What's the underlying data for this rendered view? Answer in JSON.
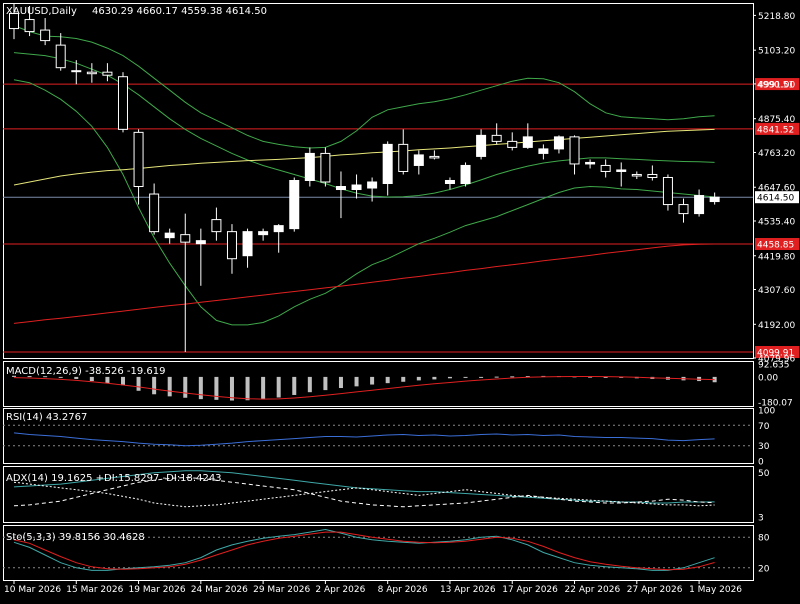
{
  "header": {
    "symbol": "XAUUSD,Daily",
    "ohlc": "4630.29 4660.17 4559.38 4614.50"
  },
  "colors": {
    "background": "#000000",
    "border": "#ffffff",
    "bull_body": "#ffffff",
    "bear_body": "#000000",
    "bollinger": "#3fa84a",
    "ma_yellow": "#e6e67a",
    "ma_red": "#e02020",
    "hline_red": "#e02020",
    "price_line": "#7b8aa8",
    "macd_hist": "#c0c0c0",
    "macd_signal": "#e02020",
    "rsi": "#3b6fd8",
    "adx_main": "#3fa8a8",
    "adx_dash": "#ffffff",
    "stoch_main": "#3fa8a8",
    "stoch_signal": "#e02020"
  },
  "chart_data": [
    {
      "type": "candlestick",
      "ylim": [
        4079.96,
        5260
      ],
      "yticks": [
        "5218.80",
        "5103.20",
        "4991.00",
        "4875.40",
        "4763.20",
        "4647.60",
        "4535.40",
        "4419.80",
        "4307.60",
        "4192.00",
        "4079.96"
      ],
      "price_tags": [
        {
          "label": "4990.51",
          "value": 4990.51
        },
        {
          "label": "4841.52",
          "value": 4841.52
        },
        {
          "label": "4614.50",
          "value": 4614.5
        },
        {
          "label": "4458.85",
          "value": 4458.85
        },
        {
          "label": "4099.91",
          "value": 4099.91
        }
      ],
      "xlabels": [
        {
          "label": "10 Mar 2026",
          "index": 0
        },
        {
          "label": "15 Mar 2026",
          "index": 4
        },
        {
          "label": "19 Mar 2026",
          "index": 8
        },
        {
          "label": "24 Mar 2026",
          "index": 12
        },
        {
          "label": "29 Mar 2026",
          "index": 16
        },
        {
          "label": "2 Apr 2026",
          "index": 20
        },
        {
          "label": "8 Apr 2026",
          "index": 24
        },
        {
          "label": "13 Apr 2026",
          "index": 28
        },
        {
          "label": "17 Apr 2026",
          "index": 32
        },
        {
          "label": "22 Apr 2026",
          "index": 36
        },
        {
          "label": "27 Apr 2026",
          "index": 40
        },
        {
          "label": "1 May 2026",
          "index": 44
        }
      ],
      "candles": [
        {
          "o": 5225,
          "h": 5260,
          "l": 5140,
          "c": 5175
        },
        {
          "o": 5205,
          "h": 5250,
          "l": 5150,
          "c": 5165
        },
        {
          "o": 5170,
          "h": 5210,
          "l": 5120,
          "c": 5135
        },
        {
          "o": 5120,
          "h": 5160,
          "l": 5035,
          "c": 5045
        },
        {
          "o": 5035,
          "h": 5070,
          "l": 4990,
          "c": 5035
        },
        {
          "o": 5030,
          "h": 5060,
          "l": 4995,
          "c": 5025
        },
        {
          "o": 5030,
          "h": 5060,
          "l": 5000,
          "c": 5020
        },
        {
          "o": 5015,
          "h": 5030,
          "l": 4830,
          "c": 4840
        },
        {
          "o": 4830,
          "h": 4840,
          "l": 4590,
          "c": 4650
        },
        {
          "o": 4625,
          "h": 4660,
          "l": 4490,
          "c": 4500
        },
        {
          "o": 4480,
          "h": 4510,
          "l": 4460,
          "c": 4495
        },
        {
          "o": 4490,
          "h": 4560,
          "l": 4100,
          "c": 4465
        },
        {
          "o": 4460,
          "h": 4510,
          "l": 4320,
          "c": 4470
        },
        {
          "o": 4540,
          "h": 4580,
          "l": 4470,
          "c": 4500
        },
        {
          "o": 4500,
          "h": 4525,
          "l": 4360,
          "c": 4410
        },
        {
          "o": 4420,
          "h": 4510,
          "l": 4380,
          "c": 4500
        },
        {
          "o": 4490,
          "h": 4510,
          "l": 4470,
          "c": 4500
        },
        {
          "o": 4500,
          "h": 4525,
          "l": 4430,
          "c": 4520
        },
        {
          "o": 4510,
          "h": 4680,
          "l": 4500,
          "c": 4670
        },
        {
          "o": 4670,
          "h": 4780,
          "l": 4650,
          "c": 4760
        },
        {
          "o": 4760,
          "h": 4780,
          "l": 4650,
          "c": 4665
        },
        {
          "o": 4640,
          "h": 4700,
          "l": 4545,
          "c": 4650
        },
        {
          "o": 4640,
          "h": 4690,
          "l": 4610,
          "c": 4655
        },
        {
          "o": 4645,
          "h": 4680,
          "l": 4600,
          "c": 4665
        },
        {
          "o": 4660,
          "h": 4800,
          "l": 4620,
          "c": 4790
        },
        {
          "o": 4790,
          "h": 4840,
          "l": 4690,
          "c": 4700
        },
        {
          "o": 4720,
          "h": 4770,
          "l": 4690,
          "c": 4755
        },
        {
          "o": 4750,
          "h": 4770,
          "l": 4740,
          "c": 4745
        },
        {
          "o": 4660,
          "h": 4680,
          "l": 4640,
          "c": 4670
        },
        {
          "o": 4660,
          "h": 4730,
          "l": 4650,
          "c": 4720
        },
        {
          "o": 4750,
          "h": 4840,
          "l": 4740,
          "c": 4820
        },
        {
          "o": 4820,
          "h": 4860,
          "l": 4790,
          "c": 4800
        },
        {
          "o": 4800,
          "h": 4830,
          "l": 4770,
          "c": 4780
        },
        {
          "o": 4780,
          "h": 4860,
          "l": 4775,
          "c": 4815
        },
        {
          "o": 4760,
          "h": 4790,
          "l": 4740,
          "c": 4775
        },
        {
          "o": 4775,
          "h": 4820,
          "l": 4760,
          "c": 4815
        },
        {
          "o": 4815,
          "h": 4820,
          "l": 4690,
          "c": 4725
        },
        {
          "o": 4725,
          "h": 4740,
          "l": 4710,
          "c": 4730
        },
        {
          "o": 4720,
          "h": 4740,
          "l": 4680,
          "c": 4700
        },
        {
          "o": 4700,
          "h": 4730,
          "l": 4650,
          "c": 4705
        },
        {
          "o": 4690,
          "h": 4700,
          "l": 4675,
          "c": 4685
        },
        {
          "o": 4690,
          "h": 4720,
          "l": 4670,
          "c": 4680
        },
        {
          "o": 4680,
          "h": 4690,
          "l": 4570,
          "c": 4590
        },
        {
          "o": 4590,
          "h": 4610,
          "l": 4530,
          "c": 4560
        },
        {
          "o": 4560,
          "h": 4640,
          "l": 4550,
          "c": 4620
        },
        {
          "o": 4600,
          "h": 4630,
          "l": 4590,
          "c": 4614.5
        }
      ],
      "bb_upper": [
        5185,
        5165,
        5150,
        5148,
        5142,
        5130,
        5110,
        5085,
        5050,
        5010,
        4970,
        4930,
        4895,
        4870,
        4845,
        4820,
        4800,
        4790,
        4782,
        4778,
        4780,
        4800,
        4835,
        4880,
        4905,
        4915,
        4925,
        4932,
        4942,
        4955,
        4970,
        4985,
        5000,
        5010,
        5008,
        4995,
        4965,
        4925,
        4895,
        4882,
        4878,
        4875,
        4872,
        4875,
        4882,
        4885
      ],
      "bb_middle": [
        5095,
        5090,
        5085,
        5075,
        5060,
        5040,
        5020,
        4990,
        4955,
        4915,
        4875,
        4840,
        4810,
        4785,
        4760,
        4738,
        4720,
        4705,
        4690,
        4675,
        4660,
        4642,
        4628,
        4618,
        4615,
        4616,
        4620,
        4628,
        4640,
        4655,
        4672,
        4690,
        4705,
        4718,
        4728,
        4735,
        4740,
        4745,
        4745,
        4742,
        4740,
        4737,
        4735,
        4733,
        4732,
        4730
      ],
      "bb_lower": [
        5005,
        4995,
        4970,
        4940,
        4900,
        4850,
        4780,
        4690,
        4580,
        4480,
        4395,
        4320,
        4250,
        4205,
        4190,
        4190,
        4198,
        4220,
        4250,
        4275,
        4295,
        4325,
        4360,
        4390,
        4410,
        4435,
        4460,
        4478,
        4498,
        4520,
        4535,
        4550,
        4570,
        4590,
        4610,
        4630,
        4645,
        4650,
        4648,
        4642,
        4640,
        4635,
        4630,
        4625,
        4620,
        4615
      ],
      "ma_yellow": [
        4655,
        4665,
        4675,
        4685,
        4692,
        4698,
        4703,
        4706,
        4710,
        4715,
        4720,
        4723,
        4727,
        4730,
        4733,
        4736,
        4738,
        4740,
        4743,
        4746,
        4750,
        4755,
        4758,
        4762,
        4765,
        4768,
        4772,
        4775,
        4778,
        4782,
        4786,
        4790,
        4794,
        4798,
        4802,
        4806,
        4810,
        4814,
        4818,
        4822,
        4826,
        4830,
        4834,
        4836,
        4838,
        4840
      ],
      "ma_red": [
        4195,
        4201,
        4207,
        4212,
        4218,
        4224,
        4230,
        4236,
        4242,
        4248,
        4254,
        4259,
        4265,
        4271,
        4277,
        4283,
        4289,
        4295,
        4301,
        4307,
        4313,
        4319,
        4325,
        4332,
        4338,
        4345,
        4351,
        4358,
        4364,
        4371,
        4377,
        4384,
        4390,
        4396,
        4403,
        4409,
        4415,
        4421,
        4428,
        4434,
        4440,
        4446,
        4452,
        4456,
        4458,
        4459
      ]
    },
    {
      "type": "bar",
      "label": "MACD(12,26,9) -38.526 -19.619",
      "yticks": [
        "92.635",
        "0.00",
        "-180.07"
      ],
      "ylim": [
        -195,
        100
      ],
      "histogram": [
        8,
        6,
        5,
        -5,
        -15,
        -30,
        -45,
        -60,
        -100,
        -125,
        -140,
        -150,
        -160,
        -165,
        -170,
        -168,
        -160,
        -148,
        -130,
        -110,
        -95,
        -80,
        -68,
        -55,
        -45,
        -35,
        -25,
        -18,
        -10,
        -5,
        0,
        2,
        4,
        6,
        7,
        6,
        4,
        2,
        0,
        -5,
        -10,
        -15,
        -20,
        -25,
        -30,
        -38.526
      ],
      "signal": [
        -5,
        -8,
        -12,
        -18,
        -25,
        -35,
        -45,
        -58,
        -72,
        -88,
        -102,
        -116,
        -128,
        -140,
        -150,
        -157,
        -160,
        -158,
        -152,
        -143,
        -132,
        -120,
        -108,
        -96,
        -84,
        -72,
        -60,
        -50,
        -40,
        -30,
        -22,
        -15,
        -8,
        -3,
        0,
        2,
        3,
        3,
        2,
        0,
        -3,
        -7,
        -10,
        -14,
        -17,
        -19.619
      ]
    },
    {
      "type": "line",
      "label": "RSI(14) 43.2767",
      "yticks": [
        "100",
        "70",
        "30",
        "0"
      ],
      "ylim": [
        0,
        100
      ],
      "values": [
        55,
        52,
        50,
        48,
        45,
        42,
        40,
        38,
        35,
        33,
        32,
        30,
        31,
        33,
        35,
        38,
        40,
        42,
        44,
        46,
        48,
        48,
        47,
        49,
        51,
        52,
        50,
        51,
        49,
        50,
        52,
        53,
        51,
        52,
        50,
        51,
        48,
        47,
        46,
        46,
        45,
        44,
        41,
        40,
        42,
        43.2767
      ]
    },
    {
      "type": "line",
      "label": "ADX(14) 19.1625 +DI:15.8297 -DI:18.4243",
      "yticks": [
        "50",
        "3"
      ],
      "ylim": [
        0,
        55
      ],
      "adx": [
        35,
        36,
        37,
        38,
        40,
        42,
        44,
        46,
        48,
        50,
        51,
        52,
        52,
        51,
        50,
        48,
        46,
        44,
        42,
        40,
        38,
        36,
        34,
        33,
        32,
        31,
        30,
        30,
        29,
        28,
        27,
        26,
        25,
        24,
        23,
        22,
        21,
        20,
        20,
        19,
        19,
        18,
        18,
        19,
        19,
        19.1625
      ],
      "plus_di": [
        40,
        38,
        36,
        34,
        32,
        30,
        28,
        25,
        22,
        18,
        16,
        14,
        15,
        16,
        18,
        20,
        22,
        24,
        26,
        28,
        30,
        32,
        34,
        32,
        30,
        28,
        26,
        28,
        30,
        32,
        30,
        28,
        26,
        25,
        24,
        23,
        22,
        21,
        20,
        19,
        18,
        17,
        16,
        16,
        15,
        15.8297
      ],
      "minus_di": [
        15,
        16,
        18,
        20,
        24,
        28,
        32,
        36,
        40,
        42,
        44,
        45,
        44,
        42,
        40,
        38,
        36,
        34,
        32,
        28,
        24,
        20,
        18,
        16,
        15,
        14,
        15,
        16,
        17,
        18,
        20,
        22,
        24,
        26,
        24,
        22,
        20,
        19,
        18,
        18,
        19,
        20,
        22,
        21,
        19,
        18.4243
      ]
    },
    {
      "type": "line",
      "label": "Sto(5,3,3) 39.8156 30.4628",
      "yticks": [
        "80",
        "20"
      ],
      "ylim": [
        0,
        100
      ],
      "main": [
        70,
        60,
        45,
        30,
        20,
        15,
        15,
        18,
        20,
        22,
        25,
        30,
        40,
        55,
        65,
        72,
        78,
        82,
        85,
        90,
        95,
        88,
        80,
        75,
        72,
        70,
        68,
        70,
        72,
        75,
        80,
        82,
        75,
        65,
        50,
        40,
        30,
        25,
        22,
        20,
        18,
        15,
        15,
        20,
        30,
        39.8156
      ],
      "signal": [
        75,
        68,
        55,
        42,
        30,
        22,
        18,
        17,
        18,
        20,
        22,
        27,
        35,
        45,
        55,
        65,
        72,
        78,
        82,
        86,
        90,
        90,
        85,
        80,
        76,
        72,
        70,
        69,
        70,
        72,
        76,
        80,
        78,
        72,
        62,
        50,
        40,
        32,
        27,
        23,
        20,
        18,
        16,
        17,
        22,
        30.4628
      ]
    }
  ]
}
